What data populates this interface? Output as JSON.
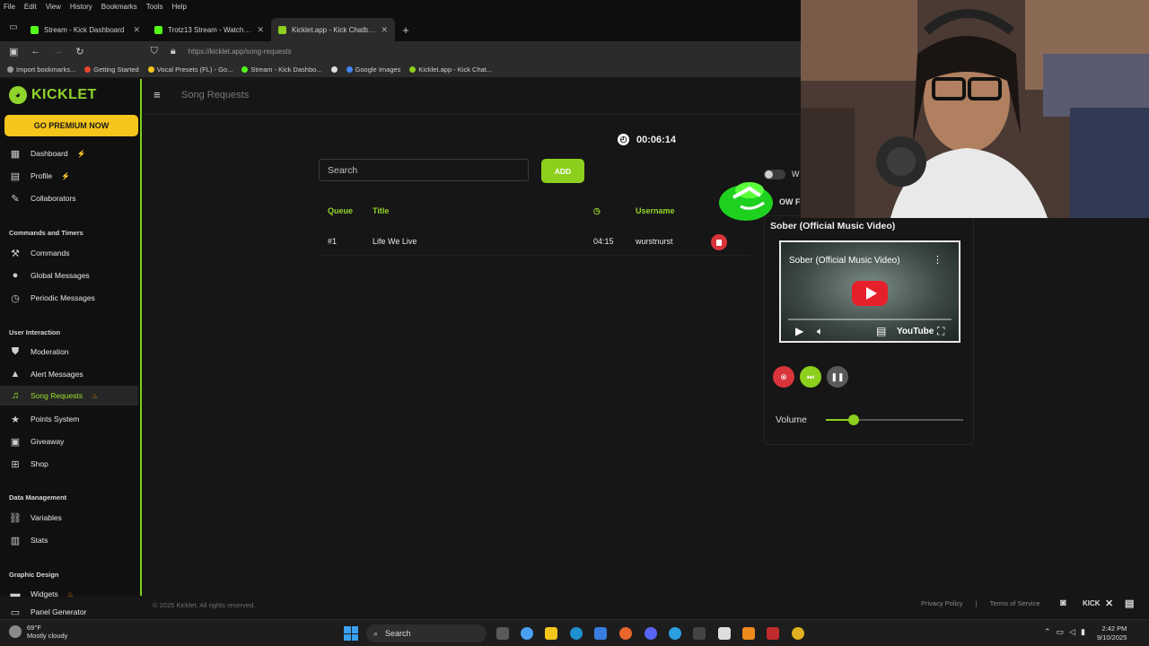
{
  "browser": {
    "menu": [
      "File",
      "Edit",
      "View",
      "History",
      "Bookmarks",
      "Tools",
      "Help"
    ],
    "tabs": [
      {
        "title": "Stream - Kick Dashboard",
        "color": "#53fc18"
      },
      {
        "title": "Trotz13 Stream - Watch Live",
        "color": "#53fc18"
      },
      {
        "title": "Kicklet.app - Kick Chatbot and",
        "color": "#8ccf1c",
        "active": true
      }
    ],
    "url": "https://kicklet.app/song-requests",
    "bookmarks": [
      {
        "label": "Import bookmarks...",
        "color": "#999999"
      },
      {
        "label": "Getting Started",
        "color": "#e8452c"
      },
      {
        "label": "Vocal Presets (FL) - Go...",
        "color": "#f5c51c"
      },
      {
        "label": "Stream - Kick Dashbo...",
        "color": "#53fc18"
      },
      {
        "label": "",
        "color": "#dddddd"
      },
      {
        "label": "Google Images",
        "color": "#4285f4"
      },
      {
        "label": "Kicklet.app - Kick Chat...",
        "color": "#8ccf1c"
      }
    ]
  },
  "sidebar": {
    "logo": "KICKLET",
    "premium": "GO PREMIUM NOW",
    "items": {
      "dashboard": "Dashboard",
      "profile": "Profile",
      "collaborators": "Collaborators",
      "commands": "Commands",
      "global_messages": "Global Messages",
      "periodic_messages": "Periodic Messages",
      "moderation": "Moderation",
      "alert_messages": "Alert Messages",
      "song_requests": "Song Requests",
      "points_system": "Points System",
      "giveaway": "Giveaway",
      "shop": "Shop",
      "variables": "Variables",
      "stats": "Stats",
      "widgets": "Widgets",
      "panel_generator": "Panel Generator"
    },
    "sections": {
      "commands": "Commands and Timers",
      "user_interaction": "User Interaction",
      "data_management": "Data Management",
      "graphic_design": "Graphic Design"
    }
  },
  "header": {
    "title": "Song Requests"
  },
  "main": {
    "timer": "00:06:14",
    "search_placeholder": "Search",
    "add_label": "ADD",
    "columns": {
      "queue": "Queue",
      "title": "Title",
      "username": "Username"
    },
    "rows": [
      {
        "queue": "#1",
        "title": "Life We Live",
        "duration": "04:15",
        "username": "wurstnurst"
      }
    ]
  },
  "player": {
    "toggle_label": "W",
    "now_label": "OW F",
    "song_title": "Sober (Official Music Video)",
    "video_title": "Sober (Official Music Video)",
    "youtube": "YouTube",
    "volume_label": "Volume",
    "volume": 0.2
  },
  "footer": {
    "copyright": "© 2025 Kicklet. All rights reserved.",
    "privacy": "Privacy Policy",
    "separator": "|",
    "terms": "Terms of Service",
    "kick": "KICK"
  },
  "taskbar": {
    "temp": "69°F",
    "weather": "Mostly cloudy",
    "search": "Search",
    "time": "2:42 PM",
    "date": "9/10/2025"
  }
}
